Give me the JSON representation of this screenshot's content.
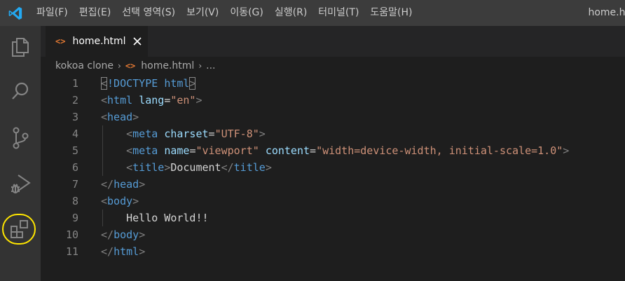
{
  "window": {
    "title": "home.ht"
  },
  "menu": [
    {
      "label": "파일(F)"
    },
    {
      "label": "편집(E)"
    },
    {
      "label": "선택 영역(S)"
    },
    {
      "label": "보기(V)"
    },
    {
      "label": "이동(G)"
    },
    {
      "label": "실행(R)"
    },
    {
      "label": "터미널(T)"
    },
    {
      "label": "도움말(H)"
    }
  ],
  "activity_bar": [
    {
      "name": "explorer",
      "icon": "files-icon"
    },
    {
      "name": "search",
      "icon": "search-icon"
    },
    {
      "name": "source-control",
      "icon": "source-control-icon"
    },
    {
      "name": "run-debug",
      "icon": "run-debug-icon"
    },
    {
      "name": "extensions",
      "icon": "extensions-icon",
      "highlighted": true
    }
  ],
  "tab": {
    "icon_glyph": "<>",
    "label": "home.html",
    "close_glyph": "×"
  },
  "breadcrumb": {
    "folder": "kokoa clone",
    "sep": "›",
    "icon_glyph": "<>",
    "file": "home.html",
    "more": "..."
  },
  "editor": {
    "lines": [
      {
        "n": "1",
        "tokens": [
          [
            "b",
            "<"
          ],
          [
            "t",
            "!DOCTYPE "
          ],
          [
            "x",
            "html"
          ],
          [
            "b",
            ">"
          ]
        ]
      },
      {
        "n": "2",
        "tokens": [
          [
            "b",
            "<"
          ],
          [
            "t",
            "html "
          ],
          [
            "a",
            "lang"
          ],
          [
            "e",
            "="
          ],
          [
            "s",
            "\"en\""
          ],
          [
            "b",
            ">"
          ]
        ]
      },
      {
        "n": "3",
        "tokens": [
          [
            "b",
            "<"
          ],
          [
            "t",
            "head"
          ],
          [
            "b",
            ">"
          ]
        ]
      },
      {
        "n": "4",
        "tokens": [
          [
            "w",
            "    "
          ],
          [
            "b",
            "<"
          ],
          [
            "t",
            "meta "
          ],
          [
            "a",
            "charset"
          ],
          [
            "e",
            "="
          ],
          [
            "s",
            "\"UTF-8\""
          ],
          [
            "b",
            ">"
          ]
        ]
      },
      {
        "n": "5",
        "tokens": [
          [
            "w",
            "    "
          ],
          [
            "b",
            "<"
          ],
          [
            "t",
            "meta "
          ],
          [
            "a",
            "name"
          ],
          [
            "e",
            "="
          ],
          [
            "s",
            "\"viewport\""
          ],
          [
            "w",
            " "
          ],
          [
            "a",
            "content"
          ],
          [
            "e",
            "="
          ],
          [
            "s",
            "\"width=device-width, initial-scale=1.0\""
          ],
          [
            "b",
            ">"
          ]
        ]
      },
      {
        "n": "6",
        "tokens": [
          [
            "w",
            "    "
          ],
          [
            "b",
            "<"
          ],
          [
            "t",
            "title"
          ],
          [
            "b",
            ">"
          ],
          [
            "w",
            "Document"
          ],
          [
            "b",
            "</"
          ],
          [
            "t",
            "title"
          ],
          [
            "b",
            ">"
          ]
        ]
      },
      {
        "n": "7",
        "tokens": [
          [
            "b",
            "</"
          ],
          [
            "t",
            "head"
          ],
          [
            "b",
            ">"
          ]
        ]
      },
      {
        "n": "8",
        "tokens": [
          [
            "b",
            "<"
          ],
          [
            "t",
            "body"
          ],
          [
            "b",
            ">"
          ]
        ]
      },
      {
        "n": "9",
        "tokens": [
          [
            "w",
            "    Hello World!!"
          ]
        ]
      },
      {
        "n": "10",
        "tokens": [
          [
            "b",
            "</"
          ],
          [
            "t",
            "body"
          ],
          [
            "b",
            ">"
          ]
        ]
      },
      {
        "n": "11",
        "tokens": [
          [
            "b",
            "</"
          ],
          [
            "t",
            "html"
          ],
          [
            "b",
            ">"
          ]
        ]
      }
    ]
  },
  "colors": {
    "titlebar": "#3c3c3c",
    "activitybar": "#333333",
    "editor_bg": "#1e1e1e",
    "tag": "#569cd6",
    "attr": "#9cdcfe",
    "string": "#ce9178",
    "bracket": "#808080",
    "highlight_ring": "#ffe600",
    "vscode_blue": "#23a9f2"
  }
}
